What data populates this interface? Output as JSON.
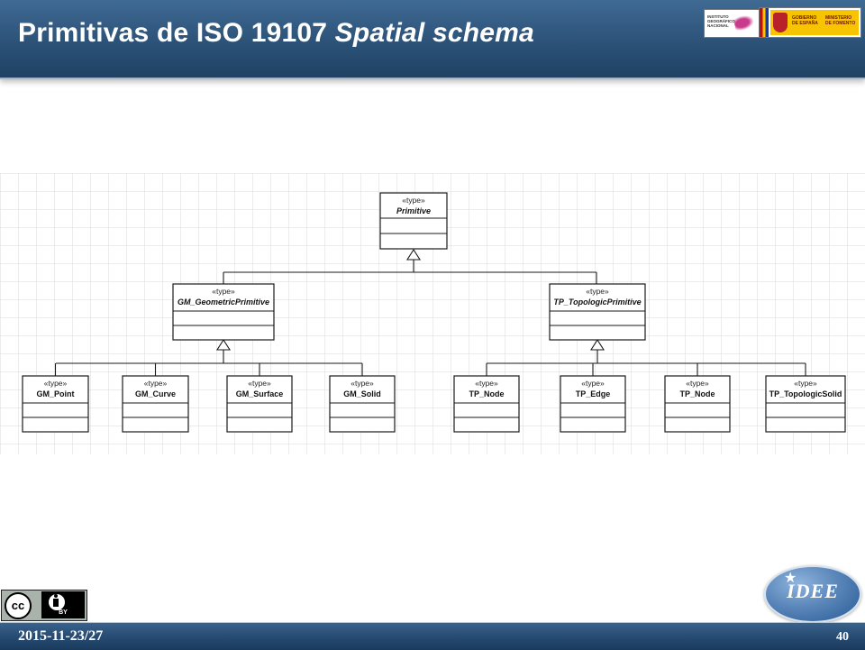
{
  "slide": {
    "title_regular": "Primitivas de ISO 19107 ",
    "title_italic": "Spatial schema"
  },
  "header": {
    "ign_logo_text": "INSTITUTO\nGEOGRÁFICO\nNACIONAL",
    "gov_logo_text_1": "GOBIERNO\nDE ESPAÑA",
    "gov_logo_text_2": "MINISTERIO\nDE FOMENTO"
  },
  "diagram": {
    "stereotype": "«type»",
    "root": {
      "name": "Primitive",
      "italic": true
    },
    "level1": [
      {
        "name": "GM_GeometricPrimitive",
        "italic": true
      },
      {
        "name": "TP_TopologicPrimitive",
        "italic": true
      }
    ],
    "level2_gm": [
      {
        "name": "GM_Point",
        "italic": false
      },
      {
        "name": "GM_Curve",
        "italic": false
      },
      {
        "name": "GM_Surface",
        "italic": false
      },
      {
        "name": "GM_Solid",
        "italic": false
      }
    ],
    "level2_tp": [
      {
        "name": "TP_Node",
        "italic": false
      },
      {
        "name": "TP_Edge",
        "italic": false
      },
      {
        "name": "TP_Node",
        "italic": false
      },
      {
        "name": "TP_TopologicSolid",
        "italic": false
      }
    ]
  },
  "footer": {
    "date": "2015-11-23/27",
    "page_number": "40"
  },
  "license": {
    "label": "BY"
  },
  "idee_logo": {
    "text": "IDEE"
  },
  "colors": {
    "header_blue": "#2c5278",
    "grid_line": "#d9d9d9",
    "uml_border": "#1a1a1a"
  }
}
